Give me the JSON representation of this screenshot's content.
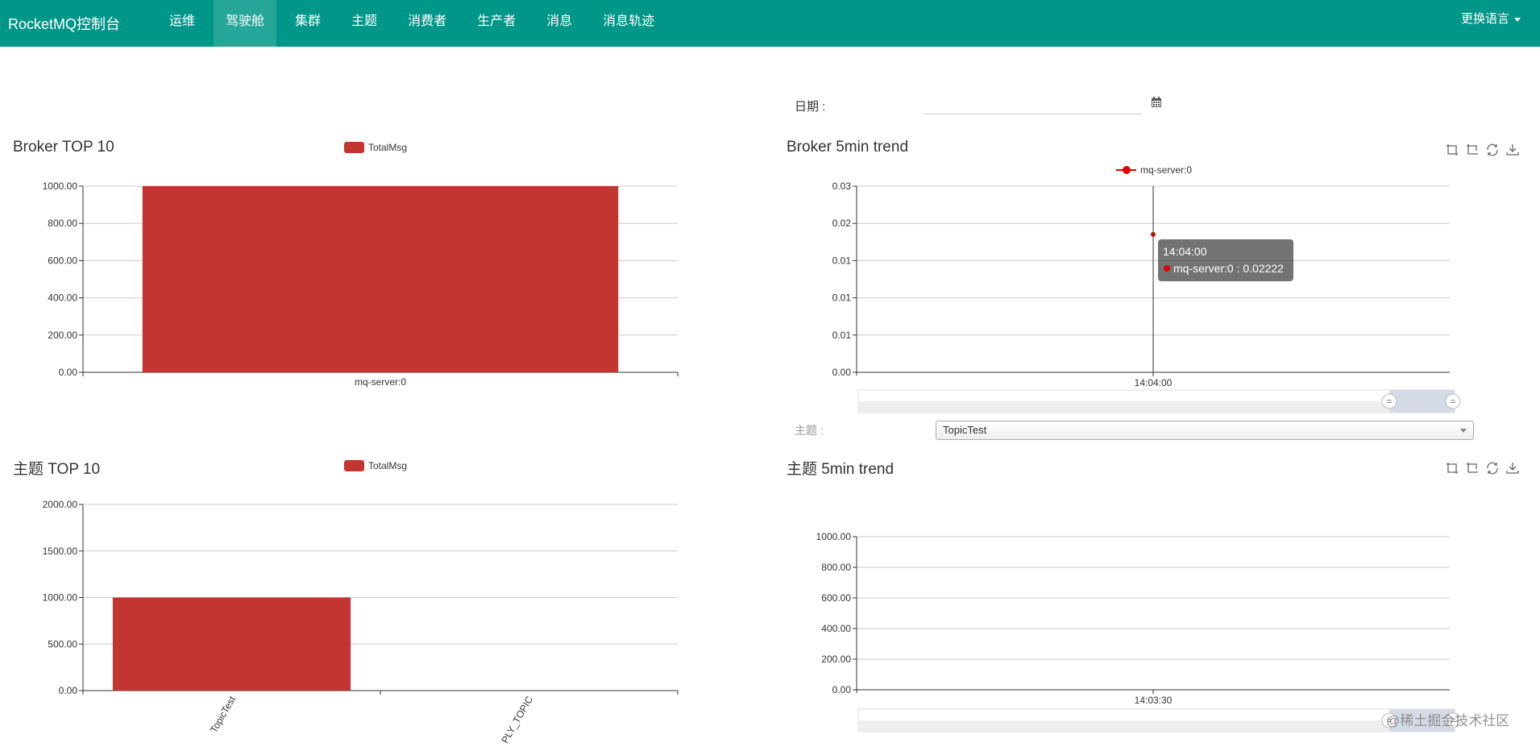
{
  "nav": {
    "brand": "RocketMQ控制台",
    "items": [
      "运维",
      "驾驶舱",
      "集群",
      "主题",
      "消费者",
      "生产者",
      "消息",
      "消息轨迹"
    ],
    "active_index": 1,
    "language": "更换语言"
  },
  "date": {
    "label": "日期 :",
    "value": "",
    "icon": "calendar-icon"
  },
  "topic_filter": {
    "label": "主题 :",
    "selected": "TopicTest"
  },
  "panels": {
    "broker_top10_title": "Broker TOP 10",
    "broker_trend_title": "Broker 5min trend",
    "topic_top10_title": "主题 TOP 10",
    "topic_trend_title": "主题 5min trend"
  },
  "toolbox_icons": [
    "zoom-icon",
    "zoom-reset-icon",
    "restore-icon",
    "save-image-icon"
  ],
  "watermark": "@稀土掘金技术社区",
  "colors": {
    "navbar": "#009688",
    "bar": "#c23531",
    "line": "#e00000"
  },
  "chart_data": [
    {
      "id": "broker_top10",
      "type": "bar",
      "categories": [
        "mq-server:0"
      ],
      "series": [
        {
          "name": "TotalMsg",
          "values": [
            1000
          ]
        }
      ],
      "ylim": [
        0,
        1000
      ],
      "yticks": [
        "0.00",
        "200.00",
        "400.00",
        "600.00",
        "800.00",
        "1000.00"
      ],
      "legend": "top-center"
    },
    {
      "id": "broker_trend",
      "type": "line",
      "x": [
        "14:04:00"
      ],
      "series": [
        {
          "name": "mq-server:0",
          "values": [
            0.02222
          ]
        }
      ],
      "ylim": [
        0,
        0.03
      ],
      "yticks": [
        "0.00",
        "0.01",
        "0.01",
        "0.01",
        "0.02",
        "0.03"
      ],
      "tooltip": {
        "title": "14:04:00",
        "text": "mq-server:0 : 0.02222"
      },
      "legend": "top-center"
    },
    {
      "id": "topic_top10",
      "type": "bar",
      "categories": [
        "TopicTest",
        "PLY_TOPIC"
      ],
      "series": [
        {
          "name": "TotalMsg",
          "values": [
            1000,
            0
          ]
        }
      ],
      "ylim": [
        0,
        2000
      ],
      "yticks": [
        "0.00",
        "500.00",
        "1000.00",
        "1500.00",
        "2000.00"
      ],
      "legend": "top-center"
    },
    {
      "id": "topic_trend",
      "type": "line",
      "x": [
        "14:03:30"
      ],
      "series": [],
      "ylim": [
        0,
        1000
      ],
      "yticks": [
        "0.00",
        "200.00",
        "400.00",
        "600.00",
        "800.00",
        "1000.00"
      ]
    }
  ]
}
